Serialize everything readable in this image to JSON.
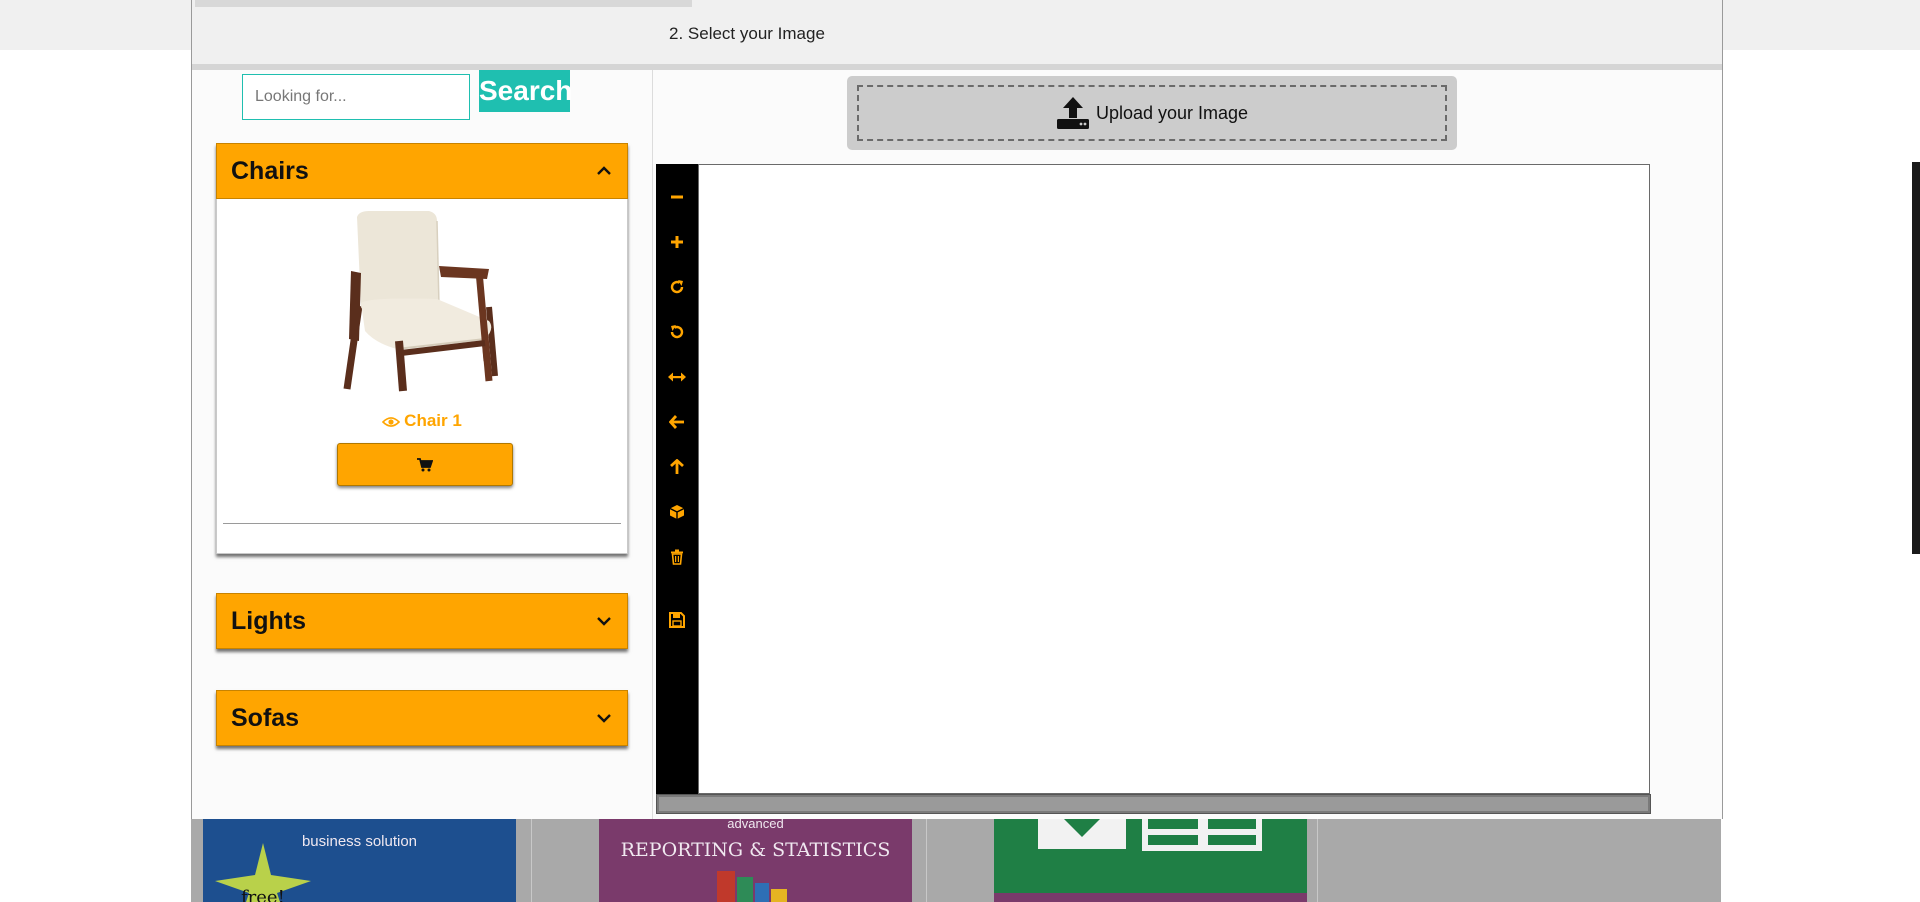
{
  "header": {
    "step_label": "2. Select your Image"
  },
  "search": {
    "placeholder": "Looking for...",
    "button_label": "Search"
  },
  "categories": [
    {
      "title": "Chairs",
      "expanded": true,
      "products": [
        {
          "name": "Chair 1"
        }
      ]
    },
    {
      "title": "Lights",
      "expanded": false
    },
    {
      "title": "Sofas",
      "expanded": false
    }
  ],
  "upload": {
    "label": "Upload your Image"
  },
  "toolbar": {
    "tools": [
      "minus-icon",
      "plus-icon",
      "rotate-right-icon",
      "rotate-left-icon",
      "flip-horizontal-icon",
      "arrow-left-icon",
      "arrow-up-icon",
      "cube-icon",
      "trash-icon",
      "save-icon"
    ]
  },
  "ads": [
    {
      "text_line1": "business solution",
      "badge": "free!"
    },
    {
      "text_line1": "advanced",
      "text_line2": "REPORTING & STATISTICS"
    },
    {
      "text_line1": ""
    }
  ],
  "colors": {
    "accent": "#ffa500",
    "teal": "#1fbfb0"
  }
}
